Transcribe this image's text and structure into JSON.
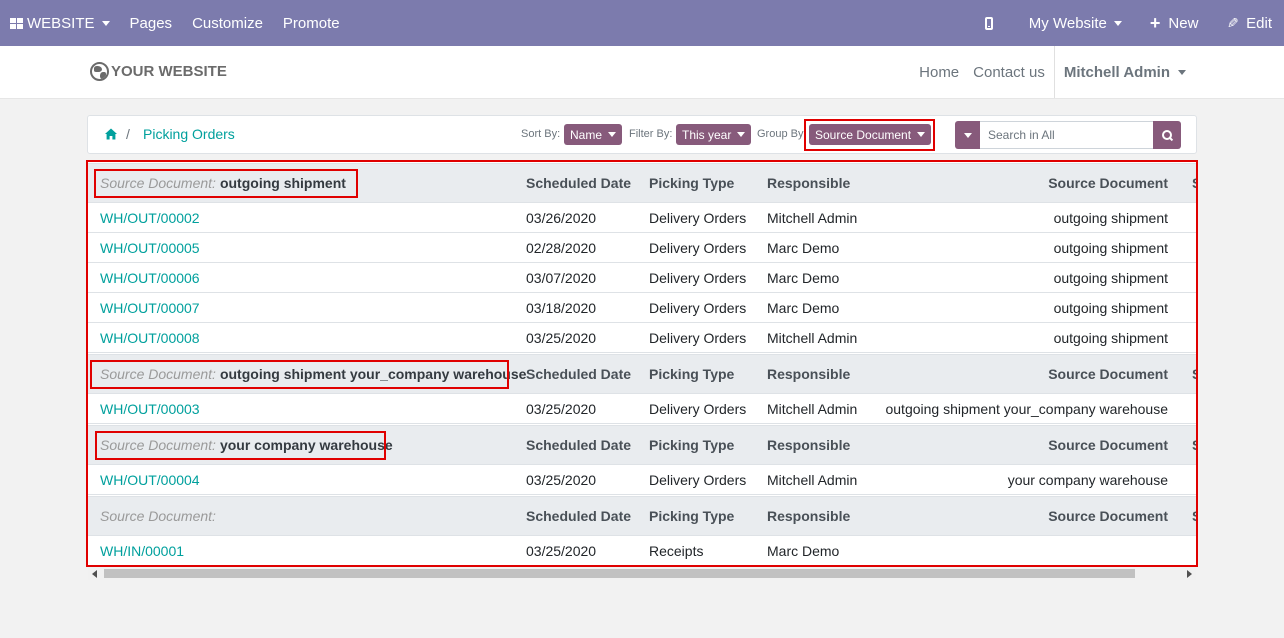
{
  "topbar": {
    "website_label": "WEBSITE",
    "pages": "Pages",
    "customize": "Customize",
    "promote": "Promote",
    "my_website": "My Website",
    "new": "New",
    "edit": "Edit"
  },
  "header": {
    "logo_text": "YOUR WEBSITE",
    "nav_home": "Home",
    "nav_contact": "Contact us",
    "user": "Mitchell Admin"
  },
  "breadcrumb": {
    "separator": "/",
    "current": "Picking Orders"
  },
  "controls": {
    "sort_label": "Sort By:",
    "sort_value": "Name",
    "filter_label": "Filter By:",
    "filter_value": "This year",
    "group_label": "Group By:",
    "group_value": "Source Document",
    "search_placeholder": "Search in All"
  },
  "table": {
    "columns": {
      "date": "Scheduled Date",
      "type": "Picking Type",
      "resp": "Responsible",
      "src": "Source Document",
      "extra": "S"
    },
    "group_label": "Source Document:",
    "groups": [
      {
        "value": "outgoing shipment",
        "rows": [
          {
            "name": "WH/OUT/00002",
            "date": "03/26/2020",
            "type": "Delivery Orders",
            "resp": "Mitchell Admin",
            "src": "outgoing shipment"
          },
          {
            "name": "WH/OUT/00005",
            "date": "02/28/2020",
            "type": "Delivery Orders",
            "resp": "Marc Demo",
            "src": "outgoing shipment"
          },
          {
            "name": "WH/OUT/00006",
            "date": "03/07/2020",
            "type": "Delivery Orders",
            "resp": "Marc Demo",
            "src": "outgoing shipment"
          },
          {
            "name": "WH/OUT/00007",
            "date": "03/18/2020",
            "type": "Delivery Orders",
            "resp": "Marc Demo",
            "src": "outgoing shipment"
          },
          {
            "name": "WH/OUT/00008",
            "date": "03/25/2020",
            "type": "Delivery Orders",
            "resp": "Mitchell Admin",
            "src": "outgoing shipment"
          }
        ]
      },
      {
        "value": "outgoing shipment your_company warehouse",
        "rows": [
          {
            "name": "WH/OUT/00003",
            "date": "03/25/2020",
            "type": "Delivery Orders",
            "resp": "Mitchell Admin",
            "src": "outgoing shipment your_company warehouse"
          }
        ]
      },
      {
        "value": "your company warehouse",
        "rows": [
          {
            "name": "WH/OUT/00004",
            "date": "03/25/2020",
            "type": "Delivery Orders",
            "resp": "Mitchell Admin",
            "src": "your company warehouse"
          }
        ]
      },
      {
        "value": "",
        "rows": [
          {
            "name": "WH/IN/00001",
            "date": "03/25/2020",
            "type": "Receipts",
            "resp": "Marc Demo",
            "src": ""
          }
        ]
      }
    ]
  },
  "colors": {
    "topbar": "#7c7bad",
    "accent": "#875a7b",
    "link": "#00a09d",
    "highlight": "#e00000"
  }
}
